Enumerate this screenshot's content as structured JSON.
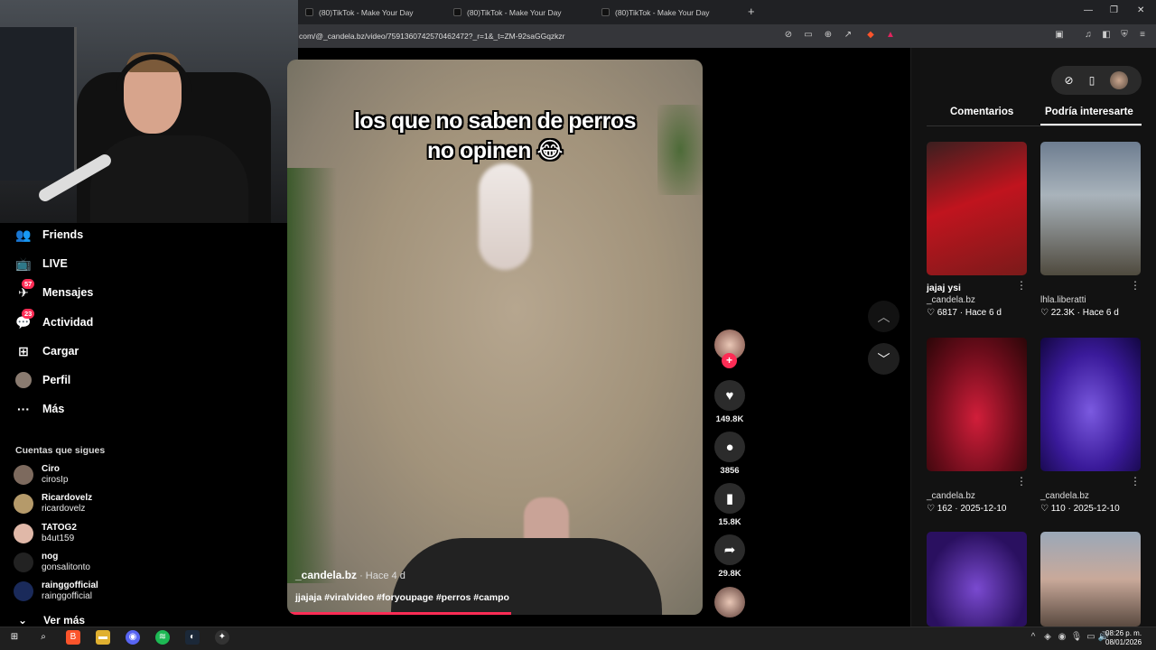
{
  "browser": {
    "tabs": [
      {
        "label": "(80)TikTok - Make Your Day"
      },
      {
        "label": "(80)TikTok - Make Your Day"
      },
      {
        "label": "(80)TikTok - Make Your Day"
      }
    ],
    "new_tab_label": "+",
    "url": "com/@_candela.bz/video/7591360742570462472?_r=1&_t=ZM-92saGGqzkzr",
    "window_controls": {
      "minimize": "—",
      "restore": "❐",
      "close": "✕"
    }
  },
  "sidebar": {
    "items": [
      {
        "label": "Friends",
        "icon": "friends-icon",
        "glyph": "👥"
      },
      {
        "label": "LIVE",
        "icon": "live-icon",
        "glyph": "📺"
      },
      {
        "label": "Mensajes",
        "icon": "messages-icon",
        "glyph": "✈",
        "badge": "57"
      },
      {
        "label": "Actividad",
        "icon": "activity-icon",
        "glyph": "💬",
        "badge": "23"
      },
      {
        "label": "Cargar",
        "icon": "upload-icon",
        "glyph": "⊞"
      },
      {
        "label": "Perfil",
        "icon": "profile-icon",
        "glyph": "●"
      },
      {
        "label": "Más",
        "icon": "more-icon",
        "glyph": "···"
      }
    ],
    "following_title": "Cuentas que sigues",
    "following": [
      {
        "name": "Ciro",
        "handle": "cirosIp"
      },
      {
        "name": "Ricardovelz",
        "handle": "ricardovelz"
      },
      {
        "name": "TATOG2",
        "handle": "b4ut159"
      },
      {
        "name": "nog",
        "handle": "gonsalitonto"
      },
      {
        "name": "rainggofficial",
        "handle": "rainggofficial"
      }
    ],
    "see_more": "Ver más"
  },
  "video": {
    "caption_line1": "los que no saben de perros",
    "caption_line2": "no opinen 😂",
    "author": "_candela.bz",
    "posted": " · Hace 4 d",
    "description": "jjajaja #viralvideo #foryoupage #perros #campo",
    "progress": 0.54
  },
  "actions": {
    "likes": "149.8K",
    "comments": "3856",
    "saves": "15.8K",
    "shares": "29.8K",
    "follow_plus": "+"
  },
  "right_panel": {
    "tabs": [
      "Comentarios",
      "Podría interesarte"
    ],
    "active_tab": "Podría interesarte",
    "cards": [
      {
        "title": "jajaj ysi",
        "author": "_candela.bz",
        "likes": "6817",
        "date": "Hace 6 d",
        "color": "#c0141e"
      },
      {
        "title": "",
        "author": "lhla.liberatti",
        "likes": "22.3K",
        "date": "Hace 6 d",
        "color": "#8d9aa5"
      },
      {
        "title": "",
        "author": "_candela.bz",
        "likes": "162",
        "date": "2025-12-10",
        "color": "#7a0f18"
      },
      {
        "title": "",
        "author": "_candela.bz",
        "likes": "110",
        "date": "2025-12-10",
        "color": "#3c1a8a"
      },
      {
        "title": "",
        "author": "",
        "likes": "",
        "date": "",
        "color": "#3a1a7a"
      },
      {
        "title": "",
        "author": "",
        "likes": "",
        "date": "",
        "color": "#a89a90"
      }
    ]
  },
  "taskbar": {
    "time": "08:26 p. m.",
    "date": "08/01/2026"
  }
}
